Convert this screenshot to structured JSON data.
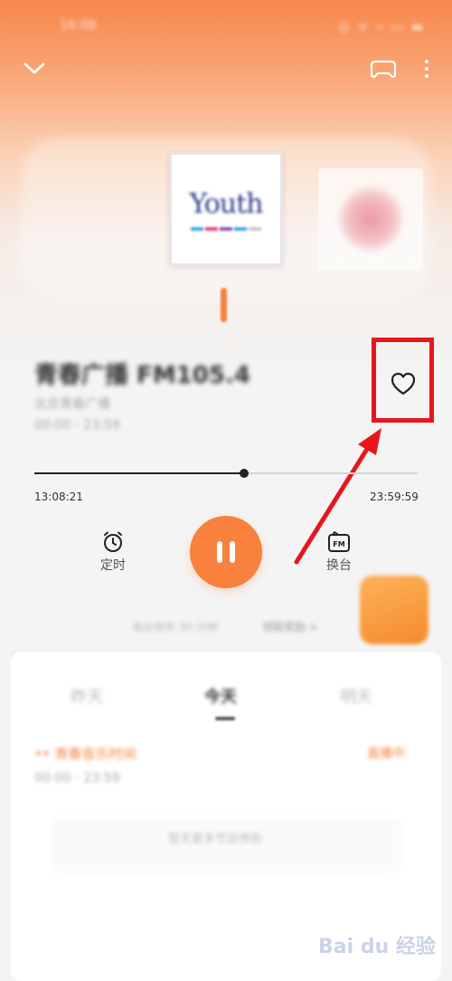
{
  "status_bar": {
    "time": "16:08",
    "icons": "◎ ᯤ ⌁ ▭ ▬"
  },
  "player": {
    "title": "青春广播 FM105.4",
    "subtitle": "北京青春广播",
    "time_range": "00:00 - 23:59",
    "cover_logo": "Youth",
    "progress": {
      "elapsed": "13:08:21",
      "total": "23:59:59",
      "fraction": 0.547
    },
    "controls": {
      "timer_label": "定时",
      "switch_label": "换台",
      "switch_badge": "FM"
    },
    "hint_text": "电台收听 30 分钟",
    "hint_link": "领取奖励 >"
  },
  "schedule": {
    "tabs": [
      "昨天",
      "今天",
      "明天"
    ],
    "current_program": "•• 青春音乐时间",
    "current_status": "直播中",
    "current_time": "00:00 - 23:59",
    "empty_text": "暂无更多节目预告"
  },
  "watermark": "Bai du 经验",
  "colors": {
    "accent": "#f7813d",
    "highlight": "#e8161c"
  }
}
